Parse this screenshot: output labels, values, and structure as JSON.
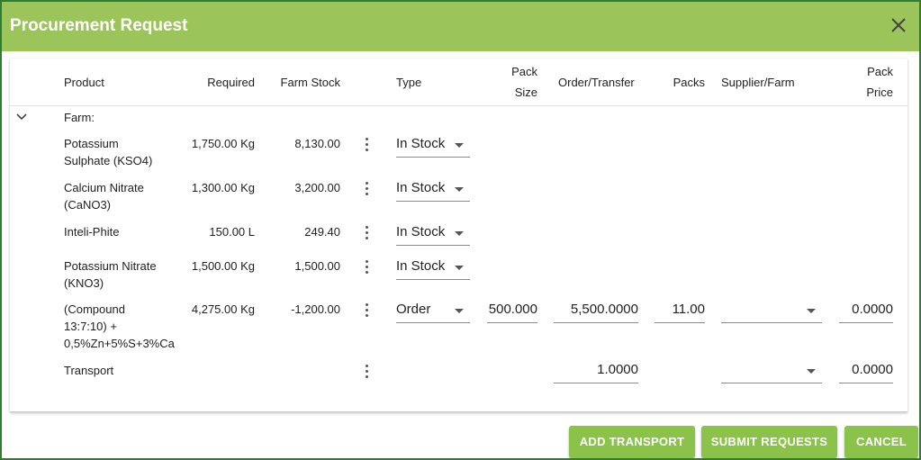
{
  "dialog": {
    "title": "Procurement Request",
    "close_icon": "close-icon"
  },
  "headers": {
    "product": "Product",
    "required": "Required",
    "farm_stock": "Farm Stock",
    "type": "Type",
    "pack_size_1": "Pack",
    "pack_size_2": "Size",
    "order_transfer": "Order/Transfer",
    "packs": "Packs",
    "supplier_farm": "Supplier/Farm",
    "pack_price_1": "Pack",
    "pack_price_2": "Price"
  },
  "group": {
    "label": "Farm:",
    "expand_icon": "chevron-down-icon"
  },
  "rows": [
    {
      "product_1": "Potassium",
      "product_2": "Sulphate (KSO4)",
      "product_3": "",
      "required": "1,750.00 Kg",
      "farm_stock": "8,130.00",
      "type": "In Stock"
    },
    {
      "product_1": "Calcium Nitrate",
      "product_2": "(CaNO3)",
      "product_3": "",
      "required": "1,300.00 Kg",
      "farm_stock": "3,200.00",
      "type": "In Stock"
    },
    {
      "product_1": "Inteli-Phite",
      "product_2": "",
      "product_3": "",
      "required": "150.00 L",
      "farm_stock": "249.40",
      "type": "In Stock"
    },
    {
      "product_1": "Potassium Nitrate",
      "product_2": "(KNO3)",
      "product_3": "",
      "required": "1,500.00 Kg",
      "farm_stock": "1,500.00",
      "type": "In Stock"
    },
    {
      "product_1": "(Compound",
      "product_2": "13:7:10) +",
      "product_3": "0,5%Zn+5%S+3%Ca",
      "required": "4,275.00 Kg",
      "farm_stock": "-1,200.00",
      "type": "Order",
      "pack_size": "500.000",
      "order_transfer": "5,500.0000",
      "packs": "11.00",
      "supplier_farm": "",
      "pack_price": "0.0000"
    }
  ],
  "transport": {
    "product": "Transport",
    "order_transfer": "1.0000",
    "supplier_farm": "",
    "pack_price": "0.0000"
  },
  "buttons": {
    "add_transport": "ADD TRANSPORT",
    "submit_requests": "SUBMIT REQUESTS",
    "cancel": "CANCEL"
  },
  "colors": {
    "header_green": "#9bc45a",
    "button_green": "#8bc34a",
    "border_green": "#2e7d32"
  }
}
